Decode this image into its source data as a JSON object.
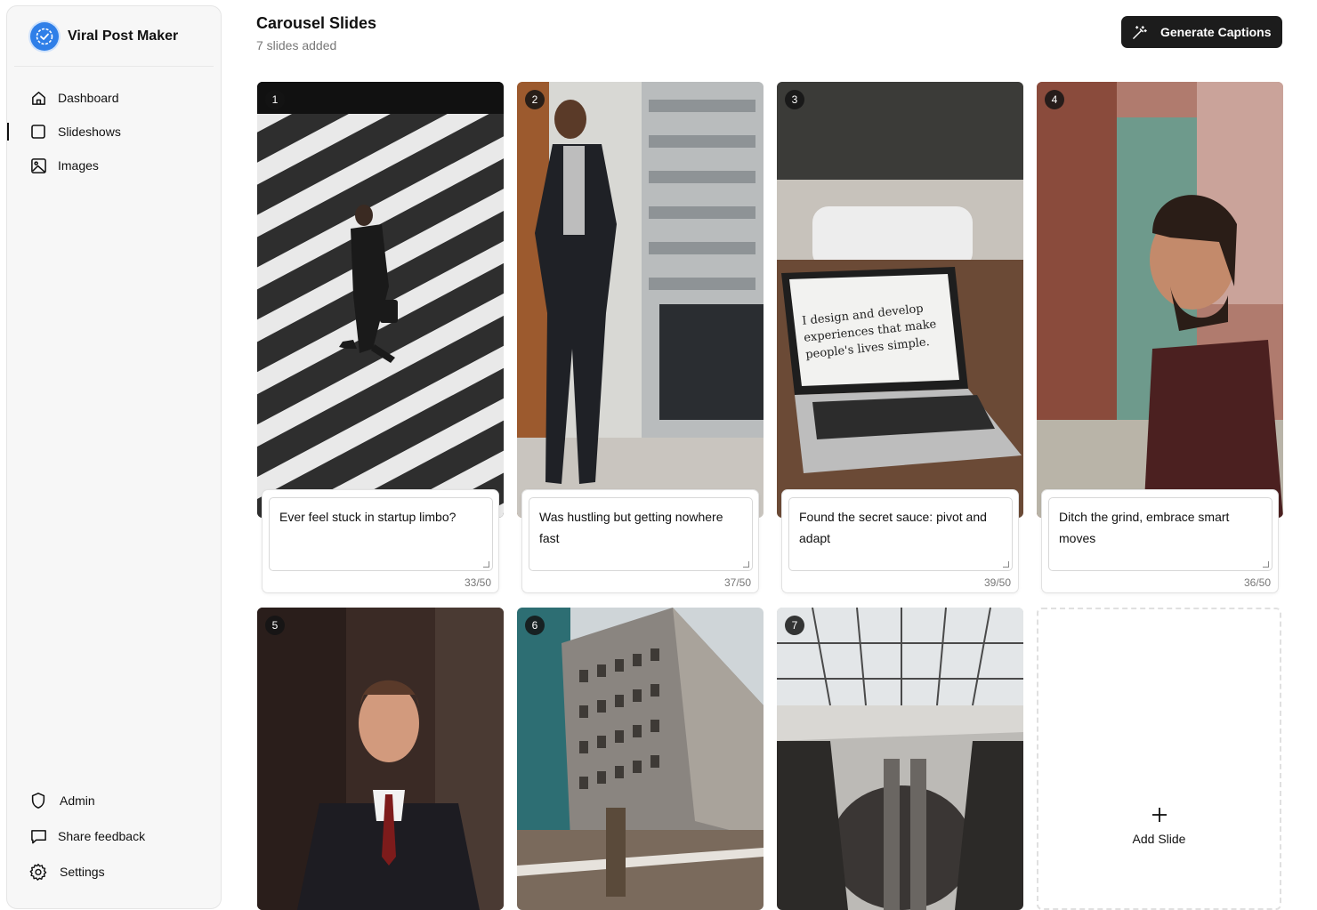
{
  "app": {
    "title": "Viral Post Maker"
  },
  "nav": {
    "items": [
      {
        "label": "Dashboard",
        "icon": "home-icon"
      },
      {
        "label": "Slideshows",
        "icon": "square-icon"
      },
      {
        "label": "Images",
        "icon": "image-icon"
      }
    ],
    "bottom": [
      {
        "label": "Admin",
        "icon": "shield-icon"
      },
      {
        "label": "Share feedback",
        "icon": "message-icon"
      },
      {
        "label": "Settings",
        "icon": "gear-icon"
      }
    ]
  },
  "header": {
    "title": "Carousel Slides",
    "subtitle": "7 slides added",
    "generate_label": "Generate Captions"
  },
  "slides": [
    {
      "number": "1",
      "caption": "Ever feel stuck in startup limbo?",
      "count": "33/50"
    },
    {
      "number": "2",
      "caption": "Was hustling but getting nowhere fast",
      "count": "37/50"
    },
    {
      "number": "3",
      "caption": "Found the secret sauce: pivot and adapt",
      "count": "39/50"
    },
    {
      "number": "4",
      "caption": "Ditch the grind, embrace smart moves",
      "count": "36/50"
    },
    {
      "number": "5"
    },
    {
      "number": "6"
    },
    {
      "number": "7"
    }
  ],
  "laptop_screen_text": "I design and develop experiences that make people's lives simple.",
  "add_slide_label": "Add Slide",
  "colors": {
    "accent": "#2f7fe8",
    "button_dark": "#1c1c1c"
  }
}
